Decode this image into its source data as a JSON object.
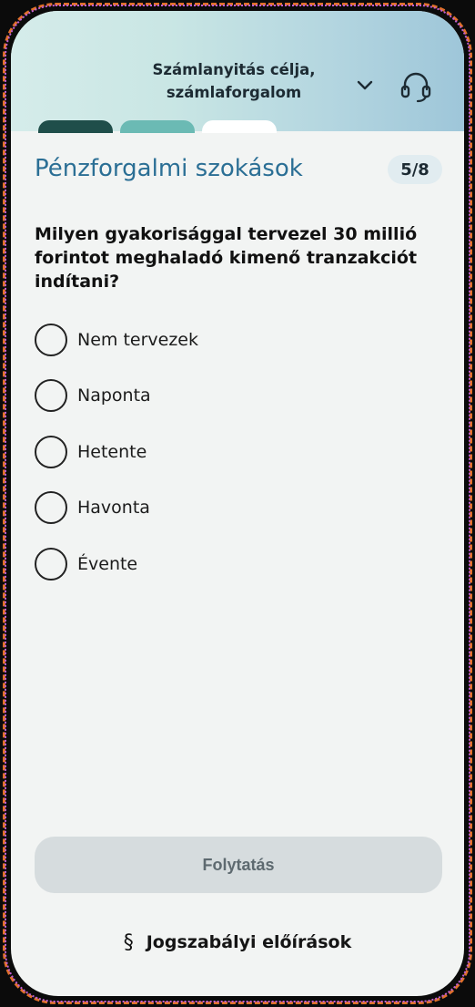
{
  "header": {
    "title_line1": "Számlanyitás célja,",
    "title_line2": "számlaforgalom",
    "chevron_icon": "chevron-down-icon",
    "support_icon": "headset-icon",
    "gradient_colors": [
      "#d5ecea",
      "#9ec6d9"
    ]
  },
  "progress": {
    "segments": [
      {
        "state": "completed",
        "color": "#1f4e4a"
      },
      {
        "state": "current",
        "color": "#6bbab4"
      },
      {
        "state": "upcoming",
        "color": "#ffffff"
      }
    ]
  },
  "section": {
    "title": "Pénzforgalmi szokások",
    "step": "5/8"
  },
  "question": {
    "text": "Milyen gyakorisággal tervezel 30 millió forintot meghaladó kimenő tranzakciót indítani?",
    "options": [
      {
        "label": "Nem tervezek",
        "selected": false
      },
      {
        "label": "Naponta",
        "selected": false
      },
      {
        "label": "Hetente",
        "selected": false
      },
      {
        "label": "Havonta",
        "selected": false
      },
      {
        "label": "Évente",
        "selected": false
      }
    ]
  },
  "actions": {
    "continue_label": "Folytatás",
    "legal_icon": "section-sign-icon",
    "legal_symbol": "§",
    "legal_label": "Jogszabályi előírások"
  },
  "colors": {
    "accent": "#2b6f95",
    "background": "#f2f4f3",
    "button_disabled": "#d6dcde"
  }
}
